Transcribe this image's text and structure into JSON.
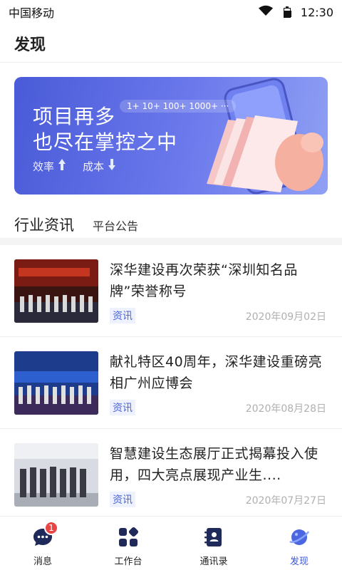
{
  "status_bar": {
    "carrier": "中国移动",
    "time": "12:30"
  },
  "header": {
    "title": "发现"
  },
  "banner": {
    "title_line1": "项目再多",
    "title_line2": "也尽在掌控之中",
    "scale_text": "1+  10+  100+  1000+  ···",
    "efficiency_label": "效率",
    "cost_label": "成本"
  },
  "tabs": [
    {
      "label": "行业资讯"
    },
    {
      "label": "平台公告"
    }
  ],
  "news": [
    {
      "title": "深华建设再次荣获“深圳知名品牌”荣誉称号",
      "tag": "资讯",
      "date": "2020年09月02日"
    },
    {
      "title": "献礼特区40周年，深华建设重磅亮相广州应博会",
      "tag": "资讯",
      "date": "2020年08月28日"
    },
    {
      "title": "智慧建设生态展厅正式揭幕投入使用，四大亮点展现产业生....",
      "tag": "资讯",
      "date": "2020年07月27日"
    }
  ],
  "bottom_nav": [
    {
      "label": "消息",
      "badge": "1"
    },
    {
      "label": "工作台"
    },
    {
      "label": "通讯录"
    },
    {
      "label": "发现"
    }
  ],
  "colors": {
    "accent": "#3b57d6",
    "banner_bg": "#5a6ae4",
    "navy_icon": "#1f2a5a",
    "badge": "#e84545"
  }
}
